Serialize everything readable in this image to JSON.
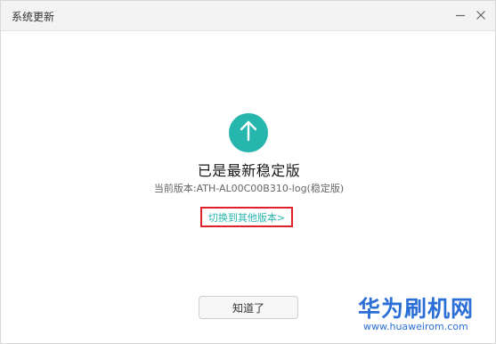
{
  "window": {
    "title": "系统更新"
  },
  "icons": {
    "minimize": "minimize-icon",
    "close": "close-icon",
    "status": "arrow-up-icon"
  },
  "colors": {
    "accent": "#27b6ae",
    "highlight_box": "#e0202a",
    "watermark": "#2b6fd6"
  },
  "main": {
    "status_title": "已是最新稳定版",
    "version_label": "当前版本:",
    "version_value": "ATH-AL00C00B310-log(稳定版)",
    "switch_link": "切换到其他版本>",
    "ok_button": "知道了"
  },
  "watermark": {
    "brand": "华为刷机网",
    "url": "www.huaweirom.com"
  }
}
